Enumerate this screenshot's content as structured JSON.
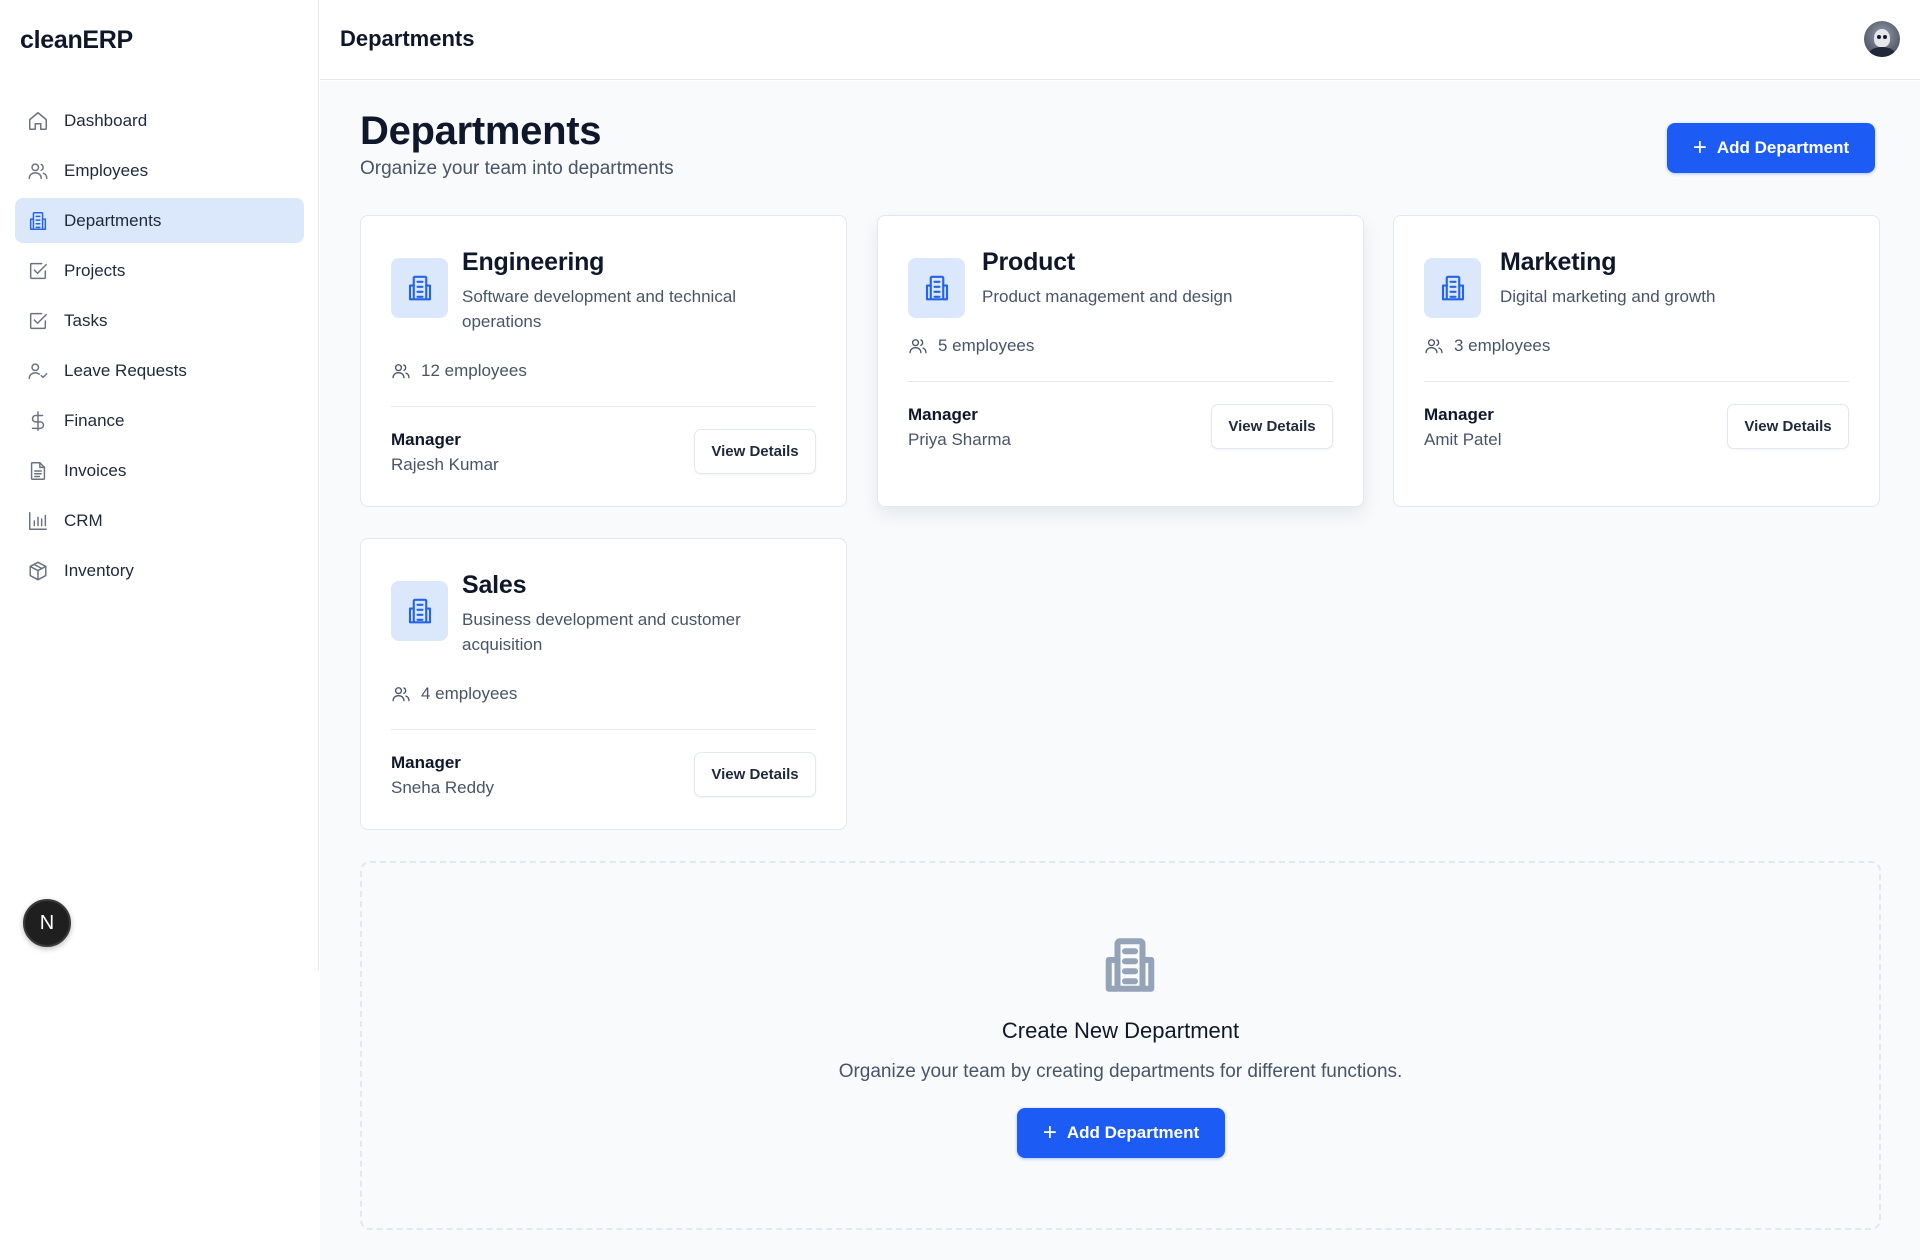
{
  "app": {
    "brand": "cleanERP"
  },
  "header": {
    "title": "Departments"
  },
  "sidebar": {
    "items": [
      {
        "label": "Dashboard",
        "icon": "home-icon",
        "active": false
      },
      {
        "label": "Employees",
        "icon": "users-icon",
        "active": false
      },
      {
        "label": "Departments",
        "icon": "building-icon",
        "active": true
      },
      {
        "label": "Projects",
        "icon": "checkbox-icon",
        "active": false
      },
      {
        "label": "Tasks",
        "icon": "checkbox-icon",
        "active": false
      },
      {
        "label": "Leave Requests",
        "icon": "user-check-icon",
        "active": false
      },
      {
        "label": "Finance",
        "icon": "dollar-icon",
        "active": false
      },
      {
        "label": "Invoices",
        "icon": "file-text-icon",
        "active": false
      },
      {
        "label": "CRM",
        "icon": "bar-chart-icon",
        "active": false
      },
      {
        "label": "Inventory",
        "icon": "package-icon",
        "active": false
      }
    ],
    "dev_badge": "N"
  },
  "page": {
    "title": "Departments",
    "subtitle": "Organize your team into departments",
    "add_button": "Add Department"
  },
  "departments": [
    {
      "name": "Engineering",
      "description": "Software development and technical operations",
      "employees": "12 employees",
      "manager_label": "Manager",
      "manager": "Rajesh Kumar",
      "view_label": "View Details"
    },
    {
      "name": "Product",
      "description": "Product management and design",
      "employees": "5 employees",
      "manager_label": "Manager",
      "manager": "Priya Sharma",
      "view_label": "View Details"
    },
    {
      "name": "Marketing",
      "description": "Digital marketing and growth",
      "employees": "3 employees",
      "manager_label": "Manager",
      "manager": "Amit Patel",
      "view_label": "View Details"
    },
    {
      "name": "Sales",
      "description": "Business development and customer acquisition",
      "employees": "4 employees",
      "manager_label": "Manager",
      "manager": "Sneha Reddy",
      "view_label": "View Details"
    }
  ],
  "create": {
    "title": "Create New Department",
    "text": "Organize your team by creating departments for different functions.",
    "button": "Add Department"
  },
  "colors": {
    "accent": "#1d5bf5",
    "active_bg": "#dbe8fb",
    "icon_blue": "#2563eb"
  }
}
